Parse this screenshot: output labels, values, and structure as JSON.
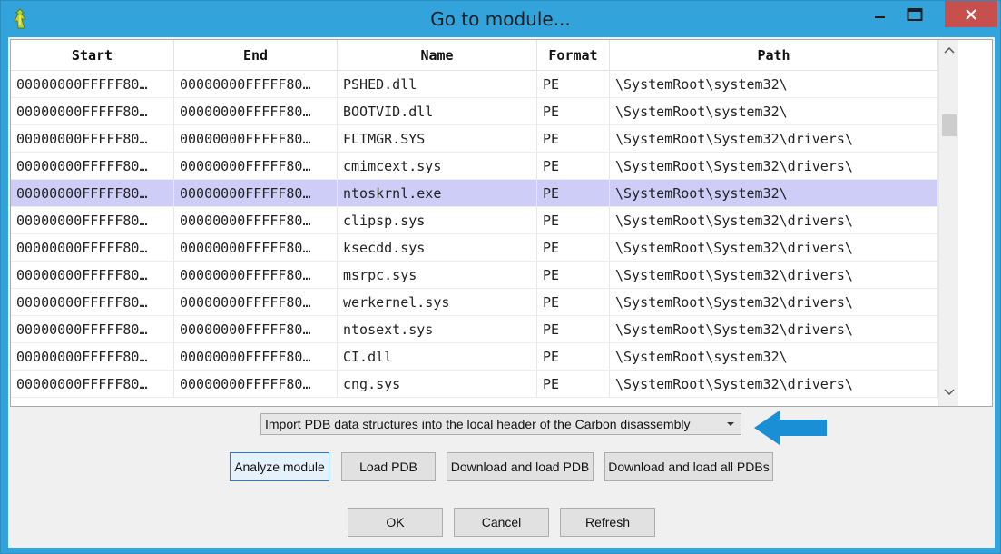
{
  "window": {
    "title": "Go to module..."
  },
  "table": {
    "columns": [
      "Start",
      "End",
      "Name",
      "Format",
      "Path"
    ],
    "rows": [
      [
        "00000000FFFFF80…",
        "00000000FFFFF80…",
        "PSHED.dll",
        "PE",
        "\\SystemRoot\\system32\\"
      ],
      [
        "00000000FFFFF80…",
        "00000000FFFFF80…",
        "BOOTVID.dll",
        "PE",
        "\\SystemRoot\\system32\\"
      ],
      [
        "00000000FFFFF80…",
        "00000000FFFFF80…",
        "FLTMGR.SYS",
        "PE",
        "\\SystemRoot\\System32\\drivers\\"
      ],
      [
        "00000000FFFFF80…",
        "00000000FFFFF80…",
        "cmimcext.sys",
        "PE",
        "\\SystemRoot\\System32\\drivers\\"
      ],
      [
        "00000000FFFFF80…",
        "00000000FFFFF80…",
        "ntoskrnl.exe",
        "PE",
        "\\SystemRoot\\system32\\"
      ],
      [
        "00000000FFFFF80…",
        "00000000FFFFF80…",
        "clipsp.sys",
        "PE",
        "\\SystemRoot\\System32\\drivers\\"
      ],
      [
        "00000000FFFFF80…",
        "00000000FFFFF80…",
        "ksecdd.sys",
        "PE",
        "\\SystemRoot\\System32\\drivers\\"
      ],
      [
        "00000000FFFFF80…",
        "00000000FFFFF80…",
        "msrpc.sys",
        "PE",
        "\\SystemRoot\\System32\\drivers\\"
      ],
      [
        "00000000FFFFF80…",
        "00000000FFFFF80…",
        "werkernel.sys",
        "PE",
        "\\SystemRoot\\System32\\drivers\\"
      ],
      [
        "00000000FFFFF80…",
        "00000000FFFFF80…",
        "ntosext.sys",
        "PE",
        "\\SystemRoot\\System32\\drivers\\"
      ],
      [
        "00000000FFFFF80…",
        "00000000FFFFF80…",
        "CI.dll",
        "PE",
        "\\SystemRoot\\system32\\"
      ],
      [
        "00000000FFFFF80…",
        "00000000FFFFF80…",
        "cng.sys",
        "PE",
        "\\SystemRoot\\System32\\drivers\\"
      ]
    ],
    "selected_row": 4
  },
  "pdb_option": {
    "selected": "Import PDB data structures into the local header of the Carbon disassembly"
  },
  "actions": {
    "analyze_label": "Analyze module",
    "load_pdb_label": "Load PDB",
    "download_load_label": "Download and load PDB",
    "download_load_all_label": "Download and load all PDBs"
  },
  "dialog_buttons": {
    "ok_label": "OK",
    "cancel_label": "Cancel",
    "refresh_label": "Refresh"
  },
  "colors": {
    "titlebar": "#33a3dc",
    "close_button": "#c7504e",
    "selected_row": "#cdcdf7",
    "pointer_arrow": "#1a8fd6"
  },
  "icons": [
    "app-icon",
    "minimize-icon",
    "maximize-icon",
    "close-icon",
    "scroll-up-icon",
    "scroll-down-icon",
    "dropdown-arrow-icon",
    "pointer-arrow-icon"
  ]
}
